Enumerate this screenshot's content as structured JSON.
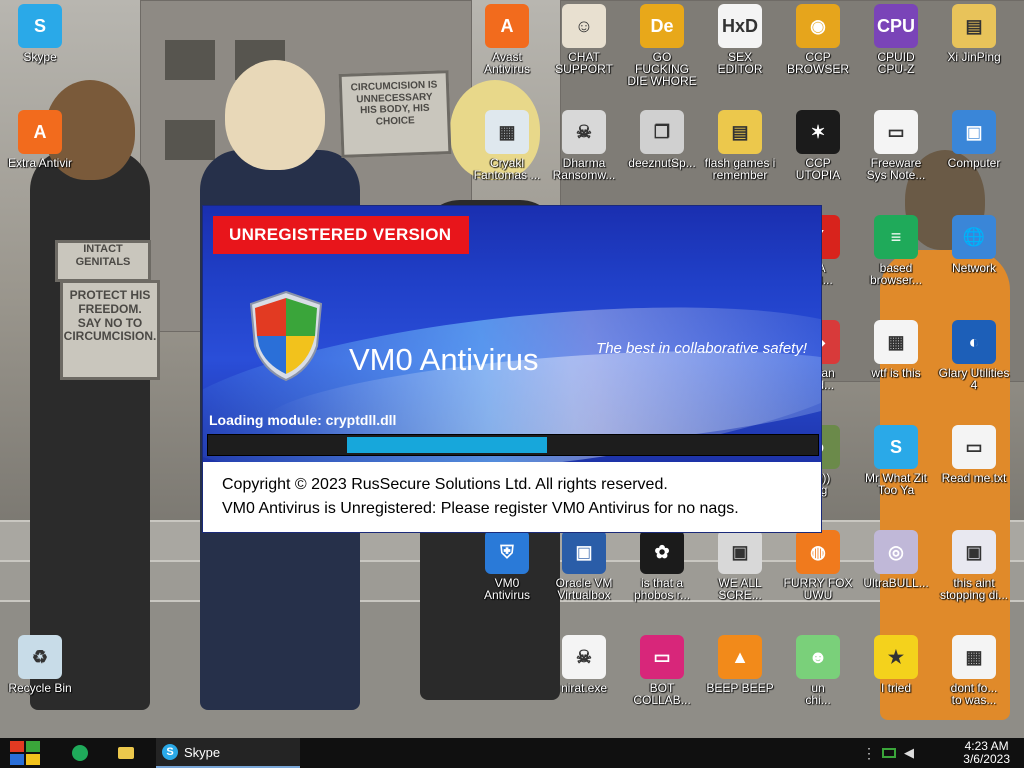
{
  "desktop": {
    "icons": [
      {
        "id": "skype",
        "label": "Skype",
        "icon": "skype-icon",
        "color": "#2aa9e8",
        "glyph": "S"
      },
      {
        "id": "extra-antivirus",
        "label": "Extra Antivir",
        "icon": "avast-icon",
        "color": "#f26b1d",
        "glyph": "A"
      },
      {
        "id": "recycle-bin",
        "label": "Recycle Bin",
        "icon": "recycle-bin-icon",
        "color": "#c8dce8",
        "glyph": "♻"
      },
      {
        "id": "avast",
        "label": "Avast\nAntivirus",
        "icon": "avast-icon",
        "color": "#f26b1d",
        "glyph": "A"
      },
      {
        "id": "chat-support",
        "label": "CHAT\nSUPPORT",
        "icon": "support-agent-icon",
        "color": "#e8e0d0",
        "glyph": "☺"
      },
      {
        "id": "go-die",
        "label": "GO FUCKING\nDIE WHORE",
        "icon": "de-logo-icon",
        "color": "#e8a81a",
        "glyph": "De"
      },
      {
        "id": "sex-editor",
        "label": "SEX EDITOR",
        "icon": "hxd-icon",
        "color": "#f4f4f4",
        "glyph": "HxD"
      },
      {
        "id": "ccp-browser",
        "label": "CCP\nBROWSER",
        "icon": "chrome-icon",
        "color": "#e6a51c",
        "glyph": "◉"
      },
      {
        "id": "cpuid",
        "label": "CPUID\nCPU-Z",
        "icon": "cpu-z-icon",
        "color": "#7a44b8",
        "glyph": "CPU"
      },
      {
        "id": "xi-jinping",
        "label": "Xi JinPing",
        "icon": "user-folder-icon",
        "color": "#e8c35a",
        "glyph": "▤"
      },
      {
        "id": "cryakl",
        "label": "Cryakl\nFantomas ...",
        "icon": "window-app-icon",
        "color": "#dfe8ee",
        "glyph": "▦"
      },
      {
        "id": "dharma",
        "label": "Dharma\nRansomw...",
        "icon": "skull-icon",
        "color": "#d8d8d8",
        "glyph": "☠"
      },
      {
        "id": "deeznut",
        "label": "deeznutSp...",
        "icon": "window-stack-icon",
        "color": "#d0d0d0",
        "glyph": "❐"
      },
      {
        "id": "flash-games",
        "label": "flash games i\nremember",
        "icon": "folder-icon",
        "color": "#ecc84c",
        "glyph": "▤"
      },
      {
        "id": "ccp-utopia",
        "label": "CCP UTOPIA",
        "icon": "ccp-logo-icon",
        "color": "#1b1b1b",
        "glyph": "✶"
      },
      {
        "id": "freeware-notes",
        "label": "Freeware\nSys Note...",
        "icon": "document-icon",
        "color": "#f4f4f4",
        "glyph": "▭"
      },
      {
        "id": "computer",
        "label": "Computer",
        "icon": "computer-icon",
        "color": "#3a86d8",
        "glyph": "▣"
      },
      {
        "id": "ya-com",
        "label": "YA\nOM...",
        "icon": "red-app-icon",
        "color": "#d8231c",
        "glyph": "Y"
      },
      {
        "id": "based-browser",
        "label": "based\nbrowser...",
        "icon": "google-sheets-icon",
        "color": "#1faa5a",
        "glyph": "≡"
      },
      {
        "id": "network",
        "label": "Network",
        "icon": "network-icon",
        "color": "#3a86d8",
        "glyph": "🌐"
      },
      {
        "id": "undan-acid",
        "label": "undan\nacid...",
        "icon": "app-icon",
        "color": "#d83a3a",
        "glyph": "◆"
      },
      {
        "id": "wtf-is-this",
        "label": "wtf is this",
        "icon": "calendar-icon",
        "color": "#f4f4f4",
        "glyph": "▦"
      },
      {
        "id": "glary",
        "label": "Glary Utilities\n4",
        "icon": "glary-icon",
        "color": "#1d5fb8",
        "glyph": "◐"
      },
      {
        "id": "ey-ling",
        "label": "ey)))\nling",
        "icon": "app-icon",
        "color": "#6b8a4a",
        "glyph": "☻"
      },
      {
        "id": "mr-what-zit",
        "label": "Mr What Zit\nToo Ya",
        "icon": "skype-icon",
        "color": "#2aa9e8",
        "glyph": "S"
      },
      {
        "id": "read-me",
        "label": "Read me.txt",
        "icon": "text-file-icon",
        "color": "#f4f4f4",
        "glyph": "▭"
      },
      {
        "id": "vm0-antivirus",
        "label": "VM0\nAntivirus",
        "icon": "shield-icon",
        "color": "#2a7ad8",
        "glyph": "⛨"
      },
      {
        "id": "oracle-vm",
        "label": "Oracle VM\nVirtualbox",
        "icon": "virtualbox-icon",
        "color": "#2a5da8",
        "glyph": "▣"
      },
      {
        "id": "is-that-a",
        "label": "is that a\nphobos r...",
        "icon": "icq-icon",
        "color": "#1b1b1b",
        "glyph": "✿"
      },
      {
        "id": "we-all-scre",
        "label": "WE ALL\nSCRE...",
        "icon": "computer-setup-icon",
        "color": "#d8d8d8",
        "glyph": "▣"
      },
      {
        "id": "furry-fox",
        "label": "FURRY FOX\nUWU",
        "icon": "firefox-icon",
        "color": "#f07a1d",
        "glyph": "◍"
      },
      {
        "id": "ultrabull",
        "label": "UltraBULL...",
        "icon": "disc-icon",
        "color": "#c0b8d8",
        "glyph": "◎"
      },
      {
        "id": "this-aint",
        "label": "this aint\nstopping di...",
        "icon": "setup-icon",
        "color": "#e8e8f0",
        "glyph": "▣"
      },
      {
        "id": "nirat",
        "label": "nirat.exe",
        "icon": "skull-icon",
        "color": "#f4f4f4",
        "glyph": "☠"
      },
      {
        "id": "bot-collab",
        "label": "BOT\nCOLLAB...",
        "icon": "monitor-icon",
        "color": "#d8267a",
        "glyph": "▭"
      },
      {
        "id": "beep-beep",
        "label": "BEEP BEEP",
        "icon": "vlc-icon",
        "color": "#f28a1a",
        "glyph": "▲"
      },
      {
        "id": "un-chi",
        "label": "un\nchi...",
        "icon": "app-icon",
        "color": "#7ad07a",
        "glyph": "☻"
      },
      {
        "id": "i-tried",
        "label": "I tried",
        "icon": "star-icon",
        "color": "#f4d21c",
        "glyph": "★"
      },
      {
        "id": "dont-forget",
        "label": "dont fo...\nto was...",
        "icon": "calendar-icon",
        "color": "#f4f4f4",
        "glyph": "▦"
      }
    ]
  },
  "wallpaper": {
    "sign_left": "INTACT\nGENITALS",
    "sign_left_small": "PROTECT HIS\nFREEDOM.\nSAY NO TO\nCIRCUMCISION.",
    "sign_top": "CIRCUMCISION IS\nUNNECESSARY\nHIS BODY, HIS CHOICE"
  },
  "splash": {
    "badge": "UNREGISTERED VERSION",
    "title": "VM0 Antivirus",
    "tagline": "The best in collaborative safety!",
    "loading_text": "Loading module: cryptdll.dll",
    "progress": {
      "start": 0.23,
      "end": 0.56
    },
    "copyright_line1": "Copyright © 2023 RusSecure Solutions Ltd. All rights reserved.",
    "copyright_line2": "VM0 Antivirus is Unregistered: Please register VM0 Antivirus for no nags."
  },
  "taskbar": {
    "skype_label": "Skype",
    "time": "4:23 AM",
    "date": "3/6/2023"
  }
}
